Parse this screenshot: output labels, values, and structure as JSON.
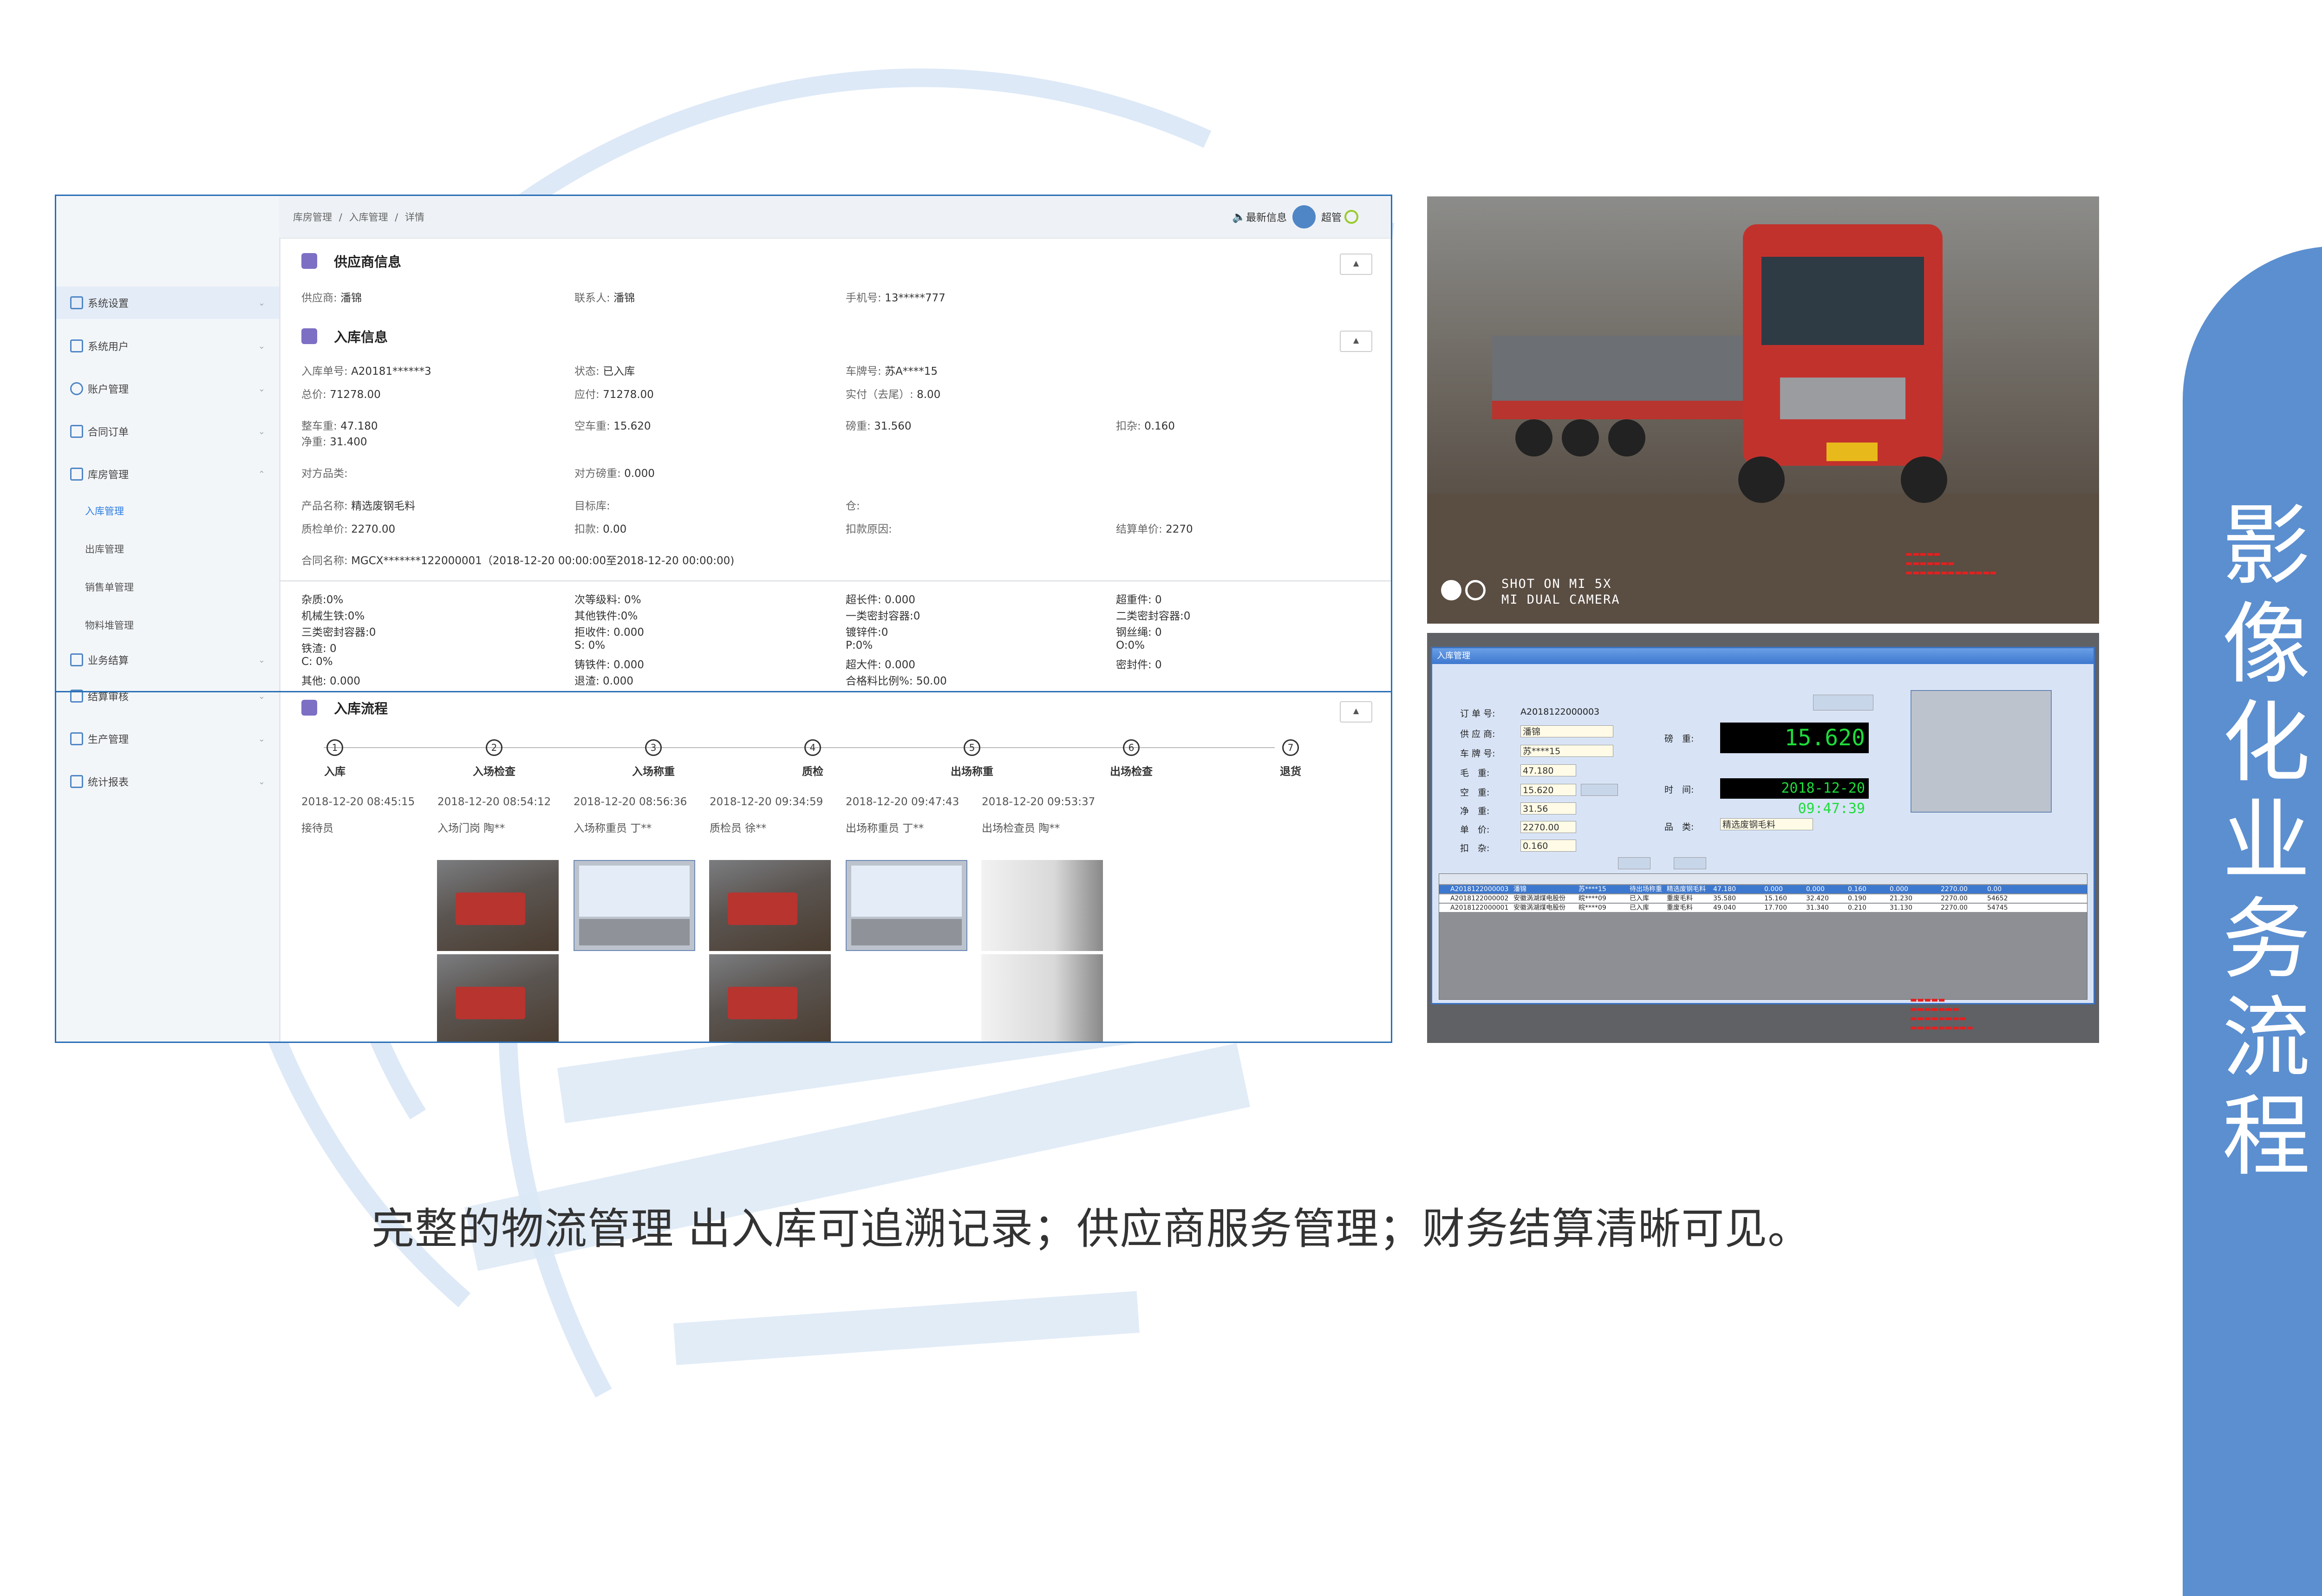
{
  "breadcrumb": [
    "库房管理",
    "/",
    "入库管理",
    "/",
    "详情"
  ],
  "header": {
    "notice": "最新信息",
    "user": "超管"
  },
  "sidebar": {
    "items": [
      {
        "label": "系统设置",
        "icon": "grid-icon"
      },
      {
        "label": "系统用户",
        "icon": "grid-icon"
      },
      {
        "label": "账户管理",
        "icon": "user-icon"
      },
      {
        "label": "合同订单",
        "icon": "doc-icon"
      },
      {
        "label": "库房管理",
        "icon": "id-card-icon"
      },
      {
        "label": "业务结算",
        "icon": "chart-icon"
      },
      {
        "label": "结算审核",
        "icon": "list-icon"
      },
      {
        "label": "生产管理",
        "icon": "truck-icon"
      },
      {
        "label": "统计报表",
        "icon": "report-icon"
      }
    ],
    "subitems": [
      "入库管理",
      "出库管理",
      "销售单管理",
      "物料堆管理"
    ]
  },
  "supplier": {
    "title": "供应商信息",
    "fields": [
      {
        "label": "供应商:",
        "value": "潘锦"
      },
      {
        "label": "联系人:",
        "value": "潘锦"
      },
      {
        "label": "手机号:",
        "value": "13*****777"
      }
    ]
  },
  "inbound": {
    "title": "入库信息",
    "rows": [
      [
        {
          "label": "入库单号:",
          "value": "A20181******3"
        },
        {
          "label": "状态:",
          "value": "已入库"
        },
        {
          "label": "车牌号:",
          "value": "苏A****15"
        }
      ],
      [
        {
          "label": "总价:",
          "value": "71278.00"
        },
        {
          "label": "应付:",
          "value": "71278.00"
        },
        {
          "label": "实付（去尾）:",
          "value": "8.00"
        }
      ],
      [
        {
          "label": "整车重:",
          "value": "47.180"
        },
        {
          "label": "空车重:",
          "value": "15.620"
        },
        {
          "label": "磅重:",
          "value": "31.560"
        },
        {
          "label": "扣杂:",
          "value": "0.160"
        }
      ],
      [
        {
          "label": "净重:",
          "value": "31.400"
        }
      ],
      [
        {
          "label": "对方品类:",
          "value": ""
        },
        {
          "label": "对方磅重:",
          "value": "0.000"
        }
      ],
      [
        {
          "label": "产品名称:",
          "value": "精选废钢毛料"
        },
        {
          "label": "目标库:",
          "value": ""
        },
        {
          "label": "仓:",
          "value": ""
        }
      ],
      [
        {
          "label": "质检单价:",
          "value": "2270.00"
        },
        {
          "label": "扣款:",
          "value": "0.00"
        },
        {
          "label": "扣款原因:",
          "value": ""
        },
        {
          "label": "结算单价:",
          "value": "2270"
        }
      ],
      [
        {
          "label": "合同名称:",
          "value": "MGCX*******122000001（2018-12-20 00:00:00至2018-12-20 00:00:00)"
        }
      ]
    ],
    "impurities": [
      [
        "杂质:0%",
        "次等级料: 0%",
        "超长件: 0.000",
        "超重件: 0"
      ],
      [
        "机械生铁:0%",
        "其他铁件:0%",
        "一类密封容器:0",
        "二类密封容器:0"
      ],
      [
        "三类密封容器:0",
        "拒收件: 0.000",
        "镀锌件:0",
        "钢丝绳: 0"
      ],
      [
        "铁渣: 0",
        "S: 0%",
        "P:0%",
        "O:0%"
      ],
      [
        "C: 0%",
        "铸铁件: 0.000",
        "超大件: 0.000",
        "密封件: 0"
      ],
      [
        "其他: 0.000",
        "退渣: 0.000",
        "合格料比例%: 50.00",
        ""
      ]
    ]
  },
  "flow": {
    "title": "入库流程",
    "steps": [
      {
        "num": "1",
        "label": "入库",
        "time": "2018-12-20 08:45:15",
        "operator": "接待员"
      },
      {
        "num": "2",
        "label": "入场检查",
        "time": "2018-12-20 08:54:12",
        "operator": "入场门岗 陶**"
      },
      {
        "num": "3",
        "label": "入场称重",
        "time": "2018-12-20 08:56:36",
        "operator": "入场称重员 丁**"
      },
      {
        "num": "4",
        "label": "质检",
        "time": "2018-12-20 09:34:59",
        "operator": "质检员 徐**"
      },
      {
        "num": "5",
        "label": "出场称重",
        "time": "2018-12-20 09:47:43",
        "operator": "出场称重员 丁**"
      },
      {
        "num": "6",
        "label": "出场检查",
        "time": "2018-12-20 09:53:37",
        "operator": "出场检查员 陶**"
      },
      {
        "num": "7",
        "label": "退货",
        "time": "",
        "operator": ""
      }
    ]
  },
  "photo": {
    "camera_line1": "SHOT ON MI 5X",
    "camera_line2": "MI DUAL CAMERA"
  },
  "desktop": {
    "title": "入库管理",
    "order_label": "订 单 号:",
    "order_value": "A2018122000003",
    "supplier_label": "供 应 商:",
    "supplier_value": "潘锦",
    "plate_label": "车 牌 号:",
    "plate_value": "苏****15",
    "gross_label": "毛　重:",
    "gross_value": "47.180",
    "tare_label": "空　重:",
    "tare_value": "15.620",
    "deduct_label": "扣　杂:",
    "deduct_value": "0.160",
    "net_label": "净　重:",
    "net_value": "31.56",
    "price_label": "单　价:",
    "price_value": "2270.00",
    "weight_label": "磅　重:",
    "weight_lcd": "15.620",
    "time_label": "时　间:",
    "time_lcd": "2018-12-20 09:47:39",
    "product_label": "品　类:",
    "product_value": "精选废钢毛料",
    "table_rows": [
      [
        "A2018122000003",
        "潘锦",
        "苏****15",
        "待出场称重",
        "精选废钢毛料",
        "47.180",
        "0.000",
        "0.000",
        "0.160",
        "0.000",
        "2270.00",
        "0.00"
      ],
      [
        "A2018122000002",
        "安徽涡湖煤电股份",
        "皖****09",
        "已入库",
        "重废毛料",
        "35.580",
        "15.160",
        "32.420",
        "0.190",
        "21.230",
        "2270.00",
        "54652"
      ],
      [
        "A2018122000001",
        "安徽涡湖煤电股份",
        "皖****09",
        "已入库",
        "重废毛料",
        "49.040",
        "17.700",
        "31.340",
        "0.210",
        "31.130",
        "2270.00",
        "54745"
      ]
    ]
  },
  "caption": "完整的物流管理 出入库可追溯记录；供应商服务管理；财务结算清晰可见。",
  "banner": [
    "影",
    "像",
    "化",
    "业",
    "务",
    "流",
    "程"
  ],
  "colors": {
    "accent": "#2f7de1",
    "banner": "#5b8fd0",
    "border": "#2a6fb5"
  }
}
